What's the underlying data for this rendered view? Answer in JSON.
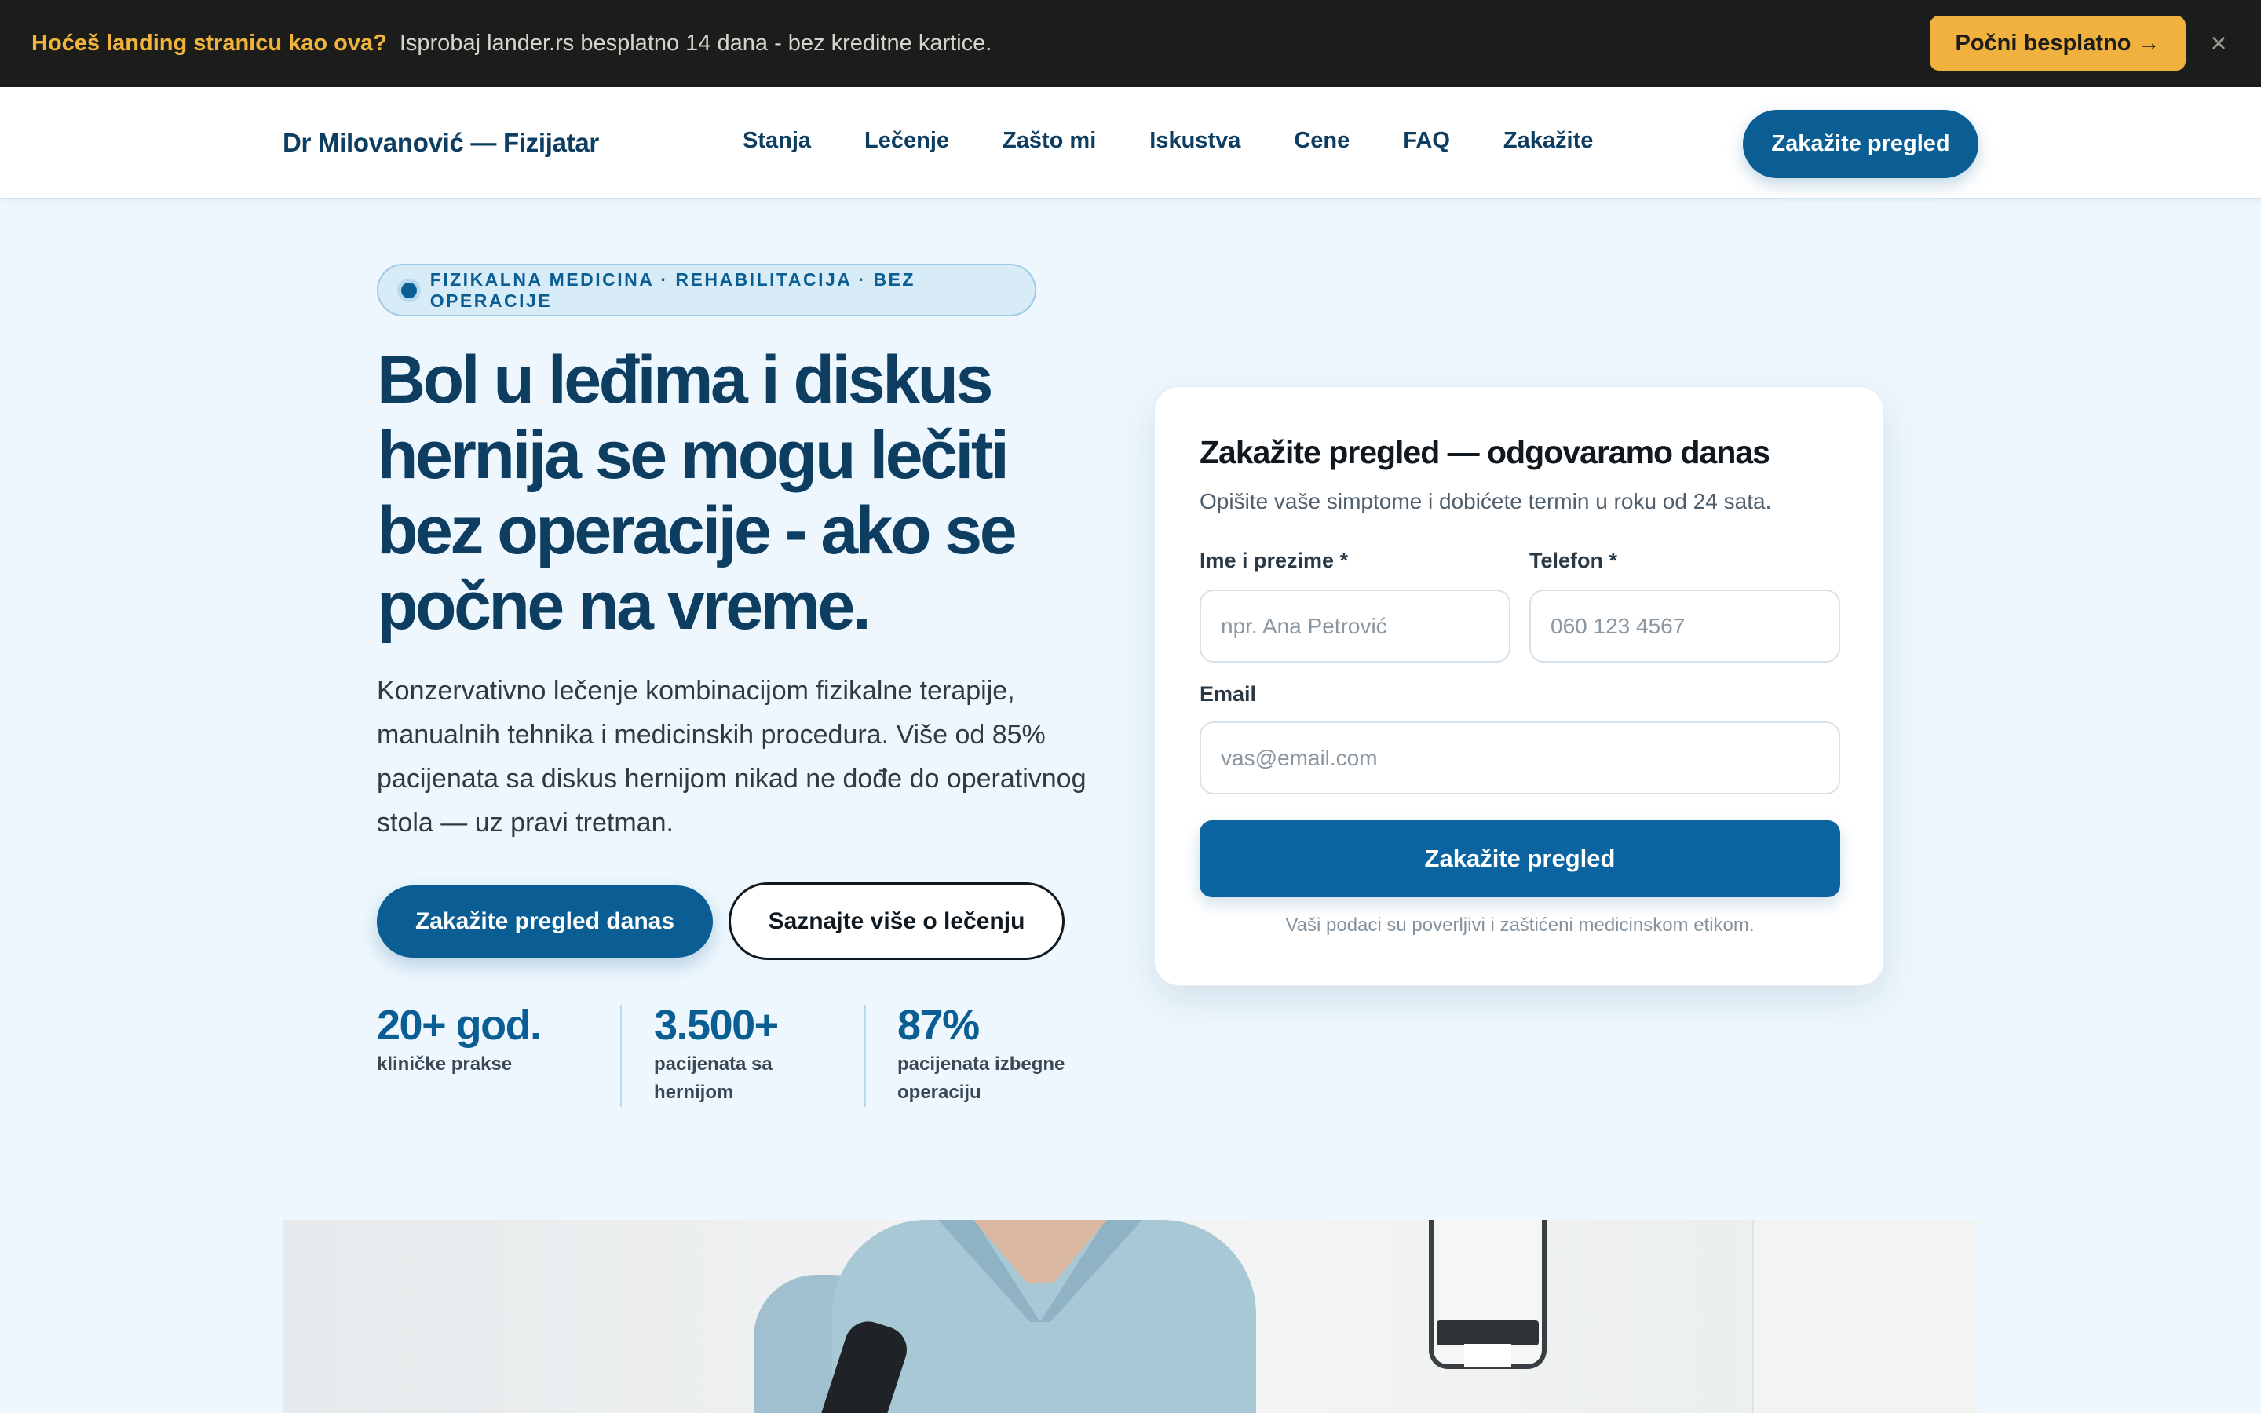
{
  "promo": {
    "highlight": "Hoćeš landing stranicu kao ova?",
    "text": "Isprobaj lander.rs besplatno 14 dana - bez kreditne kartice.",
    "cta": "Počni besplatno →",
    "close": "×"
  },
  "nav": {
    "brand": "Dr Milovanović — Fizijatar",
    "links": [
      "Stanja",
      "Lečenje",
      "Zašto mi",
      "Iskustva",
      "Cene",
      "FAQ",
      "Zakažite"
    ],
    "cta": "Zakažite pregled"
  },
  "hero": {
    "badge": "FIZIKALNA MEDICINA · REHABILITACIJA · BEZ OPERACIJE",
    "title_lines": [
      "Bol u leđima i diskus",
      "hernija se mogu lečiti",
      "bez operacije - ako se",
      "počne na vreme."
    ],
    "subtitle_lines": [
      "Konzervativno lečenje kombinacijom fizikalne terapije,",
      "manualnih tehnika i medicinskih procedura. Više od 85%",
      "pacijenata sa diskus hernijom nikad ne dođe do operativnog",
      "stola — uz pravi tretman."
    ],
    "primary_cta": "Zakažite pregled danas",
    "secondary_cta": "Saznajte više o lečenju",
    "stats": [
      {
        "value": "20+ god.",
        "label_lines": [
          "kliničke prakse"
        ]
      },
      {
        "value": "3.500+",
        "label_lines": [
          "pacijenata sa",
          "hernijom"
        ]
      },
      {
        "value": "87%",
        "label_lines": [
          "pacijenata izbegne",
          "operaciju"
        ]
      }
    ]
  },
  "form": {
    "title": "Zakažite pregled — odgovaramo danas",
    "subtitle": "Opišite vaše simptome i dobićete termin u roku od 24 sata.",
    "name_label": "Ime i prezime *",
    "name_placeholder": "npr. Ana Petrović",
    "phone_label": "Telefon *",
    "phone_placeholder": "060 123 4567",
    "email_label": "Email",
    "email_placeholder": "vas@email.com",
    "submit": "Zakažite pregled",
    "privacy": "Vaši podaci su poverljivi i zaštićeni medicinskom etikom."
  },
  "colors": {
    "primary": "#0b5e93",
    "heading": "#0d3d60",
    "accent": "#f0b13f",
    "promo_bg": "#1c1c1a",
    "page_bg": "#eef7fd"
  },
  "icons": {
    "close": "close-icon",
    "badge_dot": "dot-icon"
  }
}
